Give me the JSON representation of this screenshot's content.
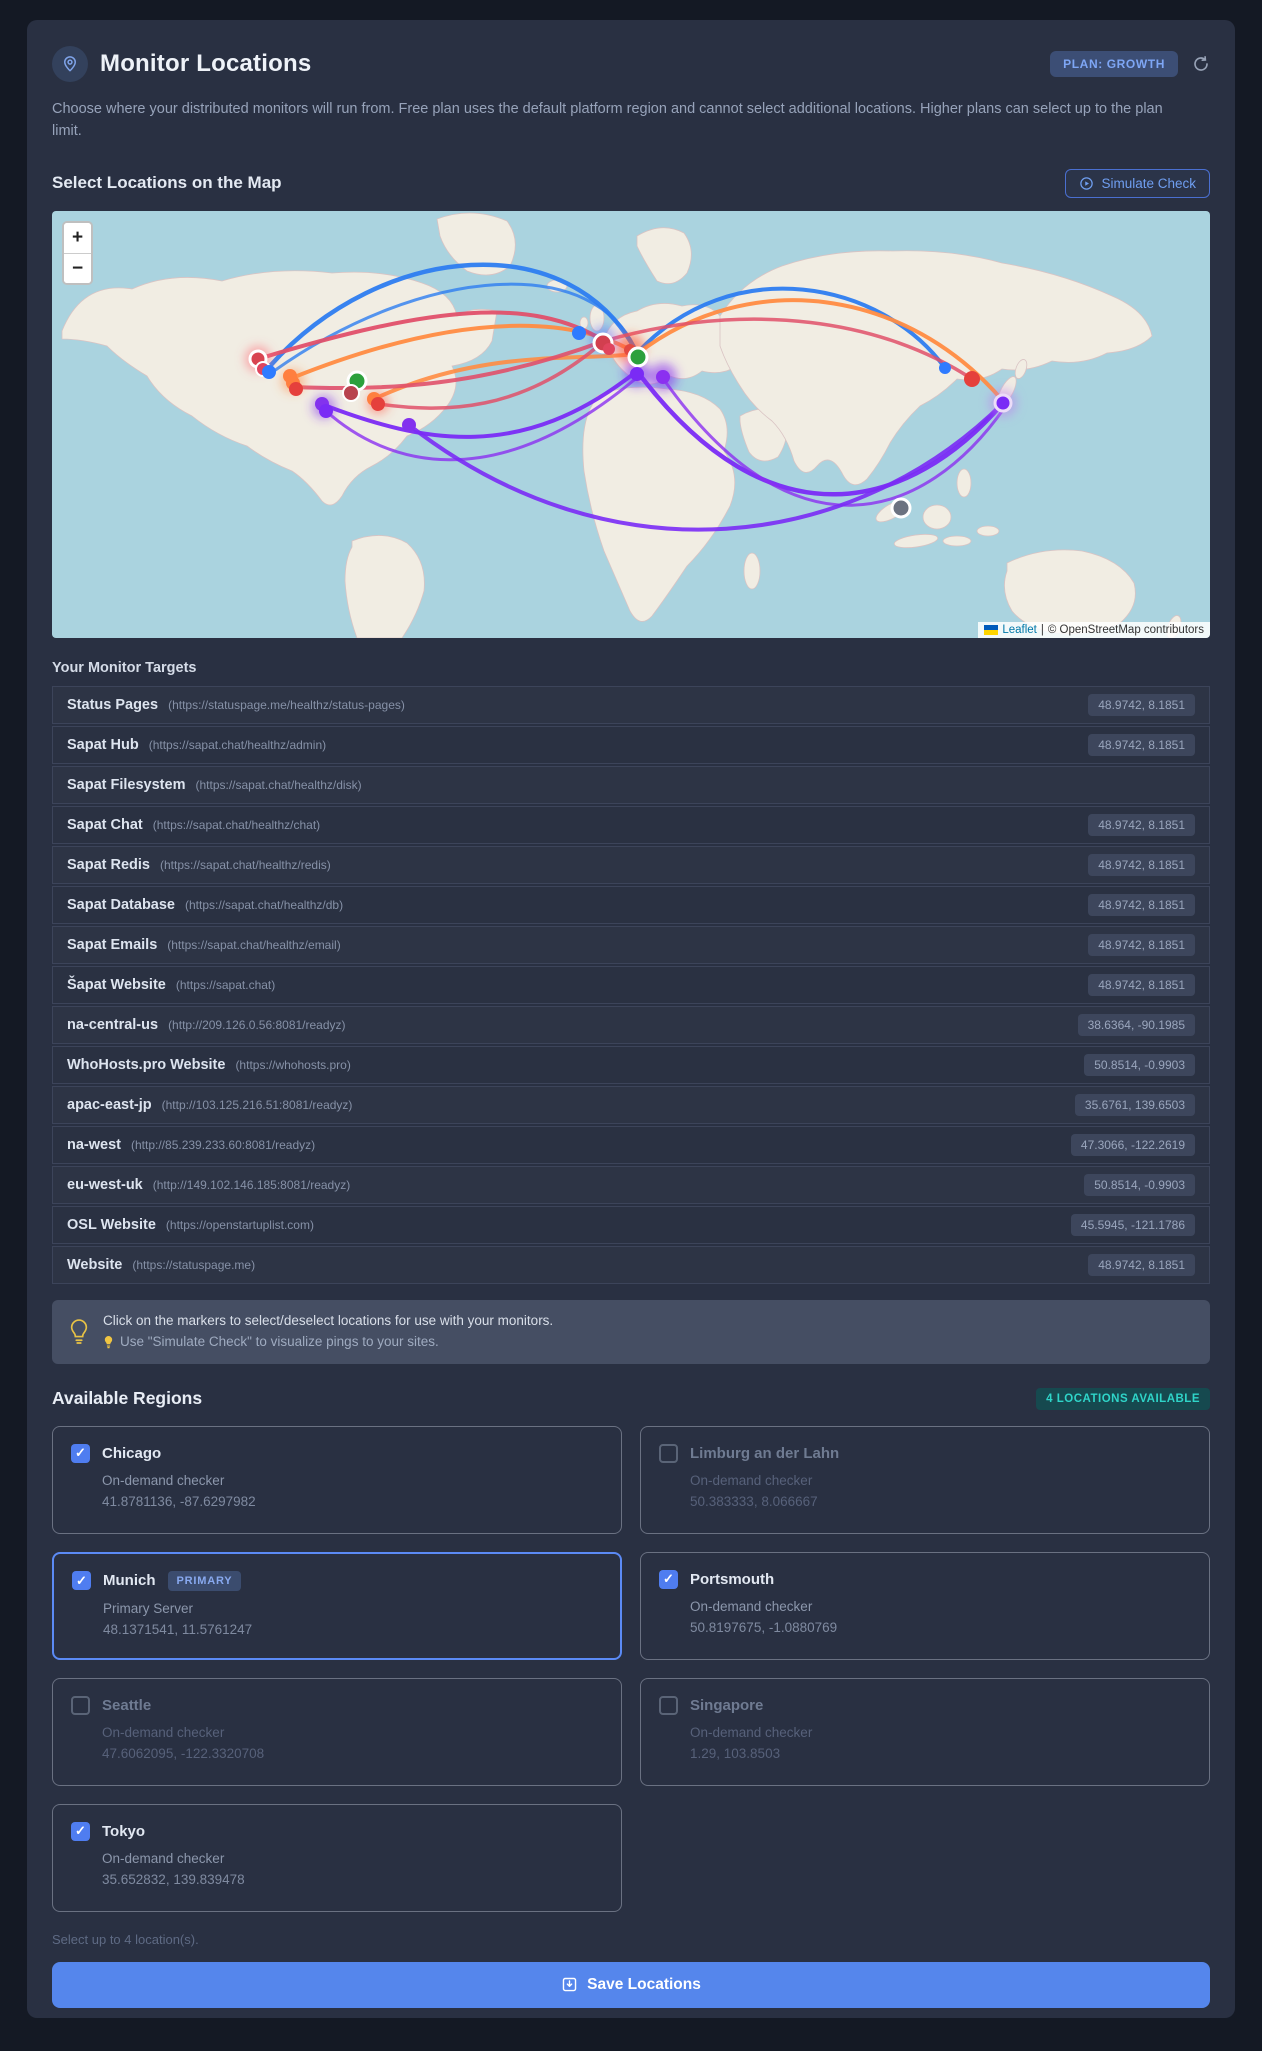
{
  "header": {
    "title": "Monitor Locations",
    "plan_badge": "PLAN: GROWTH",
    "description": "Choose where your distributed monitors will run from. Free plan uses the default platform region and cannot select additional locations. Higher plans can select up to the plan limit."
  },
  "map_section": {
    "title": "Select Locations on the Map",
    "simulate_button": "Simulate Check",
    "zoom_in": "+",
    "zoom_out": "−",
    "attribution": {
      "leaflet": "Leaflet",
      "separator": "|",
      "osm": "© OpenStreetMap contributors"
    },
    "arc_colors": [
      "#2d7df0",
      "#ff8c42",
      "#e0506a",
      "#7a2bf5"
    ],
    "marker_colors": {
      "selected_region": "#2ca03c",
      "target_red": "#d84450",
      "target_orange": "#ff7f3f",
      "target_blue": "#2f7bff",
      "target_purple": "#8332ee",
      "unselected_gray": "#6b7280"
    }
  },
  "targets": {
    "title": "Your Monitor Targets",
    "rows": [
      {
        "name": "Status Pages",
        "url": "(https://statuspage.me/healthz/status-pages)",
        "coords": "48.9742, 8.1851"
      },
      {
        "name": "Sapat Hub",
        "url": "(https://sapat.chat/healthz/admin)",
        "coords": "48.9742, 8.1851"
      },
      {
        "name": "Sapat Filesystem",
        "url": "(https://sapat.chat/healthz/disk)",
        "coords": ""
      },
      {
        "name": "Sapat Chat",
        "url": "(https://sapat.chat/healthz/chat)",
        "coords": "48.9742, 8.1851"
      },
      {
        "name": "Sapat Redis",
        "url": "(https://sapat.chat/healthz/redis)",
        "coords": "48.9742, 8.1851"
      },
      {
        "name": "Sapat Database",
        "url": "(https://sapat.chat/healthz/db)",
        "coords": "48.9742, 8.1851"
      },
      {
        "name": "Sapat Emails",
        "url": "(https://sapat.chat/healthz/email)",
        "coords": "48.9742, 8.1851"
      },
      {
        "name": "Šapat Website",
        "url": "(https://sapat.chat)",
        "coords": "48.9742, 8.1851"
      },
      {
        "name": "na-central-us",
        "url": "(http://209.126.0.56:8081/readyz)",
        "coords": "38.6364, -90.1985"
      },
      {
        "name": "WhoHosts.pro Website",
        "url": "(https://whohosts.pro)",
        "coords": "50.8514, -0.9903"
      },
      {
        "name": "apac-east-jp",
        "url": "(http://103.125.216.51:8081/readyz)",
        "coords": "35.6761, 139.6503"
      },
      {
        "name": "na-west",
        "url": "(http://85.239.233.60:8081/readyz)",
        "coords": "47.3066, -122.2619"
      },
      {
        "name": "eu-west-uk",
        "url": "(http://149.102.146.185:8081/readyz)",
        "coords": "50.8514, -0.9903"
      },
      {
        "name": "OSL Website",
        "url": "(https://openstartuplist.com)",
        "coords": "45.5945, -121.1786"
      },
      {
        "name": "Website",
        "url": "(https://statuspage.me)",
        "coords": "48.9742, 8.1851"
      }
    ]
  },
  "tip": {
    "line1": "Click on the markers to select/deselect locations for use with your monitors.",
    "line2": "Use \"Simulate Check\" to visualize pings to your sites."
  },
  "regions": {
    "title": "Available Regions",
    "badge": "4 LOCATIONS AVAILABLE",
    "cards": [
      {
        "name": "Chicago",
        "sub": "On-demand checker",
        "coords": "41.8781136, -87.6297982",
        "checked": true
      },
      {
        "name": "Limburg an der Lahn",
        "sub": "On-demand checker",
        "coords": "50.383333, 8.066667",
        "checked": false
      },
      {
        "name": "Munich",
        "badge": "PRIMARY",
        "sub": "Primary Server",
        "coords": "48.1371541, 11.5761247",
        "checked": true
      },
      {
        "name": "Portsmouth",
        "sub": "On-demand checker",
        "coords": "50.8197675, -1.0880769",
        "checked": true
      },
      {
        "name": "Seattle",
        "sub": "On-demand checker",
        "coords": "47.6062095, -122.3320708",
        "checked": false
      },
      {
        "name": "Singapore",
        "sub": "On-demand checker",
        "coords": "1.29, 103.8503",
        "checked": false
      },
      {
        "name": "Tokyo",
        "sub": "On-demand checker",
        "coords": "35.652832, 139.839478",
        "checked": true
      }
    ],
    "footer": "Select up to 4 location(s)."
  },
  "save_button": "Save Locations",
  "colors": {
    "accent_blue": "#5586ec",
    "teal_badge": "#2fd4c8",
    "card_bg": "#293042",
    "page_bg": "#141924"
  }
}
